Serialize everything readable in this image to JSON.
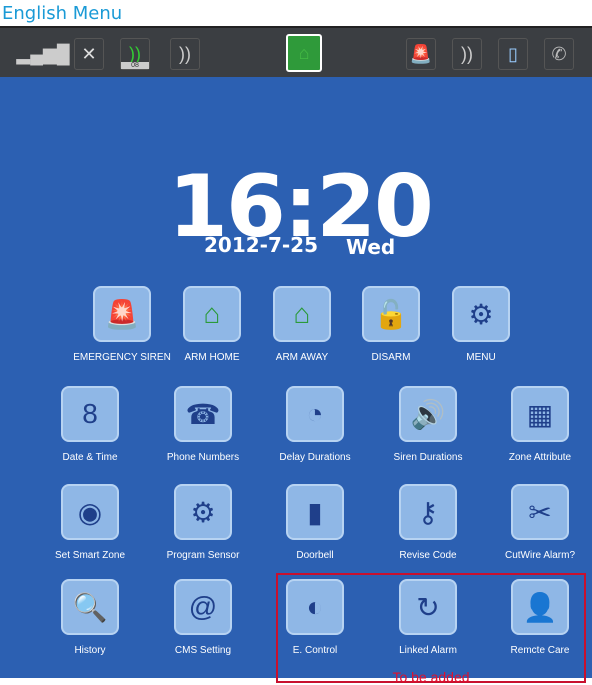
{
  "title": "English Menu",
  "status_icons": [
    "signal-icon",
    "no-sim-icon",
    "zone-sensor-icon",
    "remote-care-icon",
    "home-armed-icon",
    "siren-icon",
    "door-sensor-icon",
    "door-icon",
    "phone-line-cut-icon"
  ],
  "status_zone_number": "08",
  "clock": {
    "time": "16:20",
    "date": "2012-7-25",
    "day": "Wed"
  },
  "main_buttons": [
    {
      "label": "EMERGENCY SIREN",
      "icon": "siren-icon"
    },
    {
      "label": "ARM HOME",
      "icon": "arm-home-icon"
    },
    {
      "label": "ARM AWAY",
      "icon": "arm-away-icon"
    },
    {
      "label": "DISARM",
      "icon": "unlock-icon"
    },
    {
      "label": "MENU",
      "icon": "gear-icon"
    }
  ],
  "grid": [
    {
      "label": "Date & Time",
      "icon": "calendar-icon",
      "glyph": "8"
    },
    {
      "label": "Phone Numbers",
      "icon": "phone-book-icon",
      "glyph": "☎"
    },
    {
      "label": "Delay Durations",
      "icon": "clock-icon",
      "glyph": "◔"
    },
    {
      "label": "Siren Durations",
      "icon": "speaker-icon",
      "glyph": "🔊"
    },
    {
      "label": "Zone Attribute",
      "icon": "zone-wrench-icon",
      "glyph": "▦"
    },
    {
      "label": "Set Smart Zone",
      "icon": "radar-icon",
      "glyph": "◉"
    },
    {
      "label": "Program Sensor",
      "icon": "sensor-icon",
      "glyph": "⚙"
    },
    {
      "label": "Doorbell",
      "icon": "doorbell-icon",
      "glyph": "▮"
    },
    {
      "label": "Revise Code",
      "icon": "keys-icon",
      "glyph": "⚷"
    },
    {
      "label": "CutWire Alarm?",
      "icon": "cut-wire-icon",
      "glyph": "✂"
    },
    {
      "label": "History",
      "icon": "history-search-icon",
      "glyph": "🔍"
    },
    {
      "label": "CMS Setting",
      "icon": "cms-laptop-icon",
      "glyph": "@"
    },
    {
      "label": "E. Control",
      "icon": "e-control-icon",
      "glyph": "◐"
    },
    {
      "label": "Linked Alarm",
      "icon": "linked-alarm-icon",
      "glyph": "↻"
    },
    {
      "label": "Remcte Care",
      "icon": "remote-care-icon",
      "glyph": "👤"
    }
  ],
  "to_be_added": "To be added"
}
